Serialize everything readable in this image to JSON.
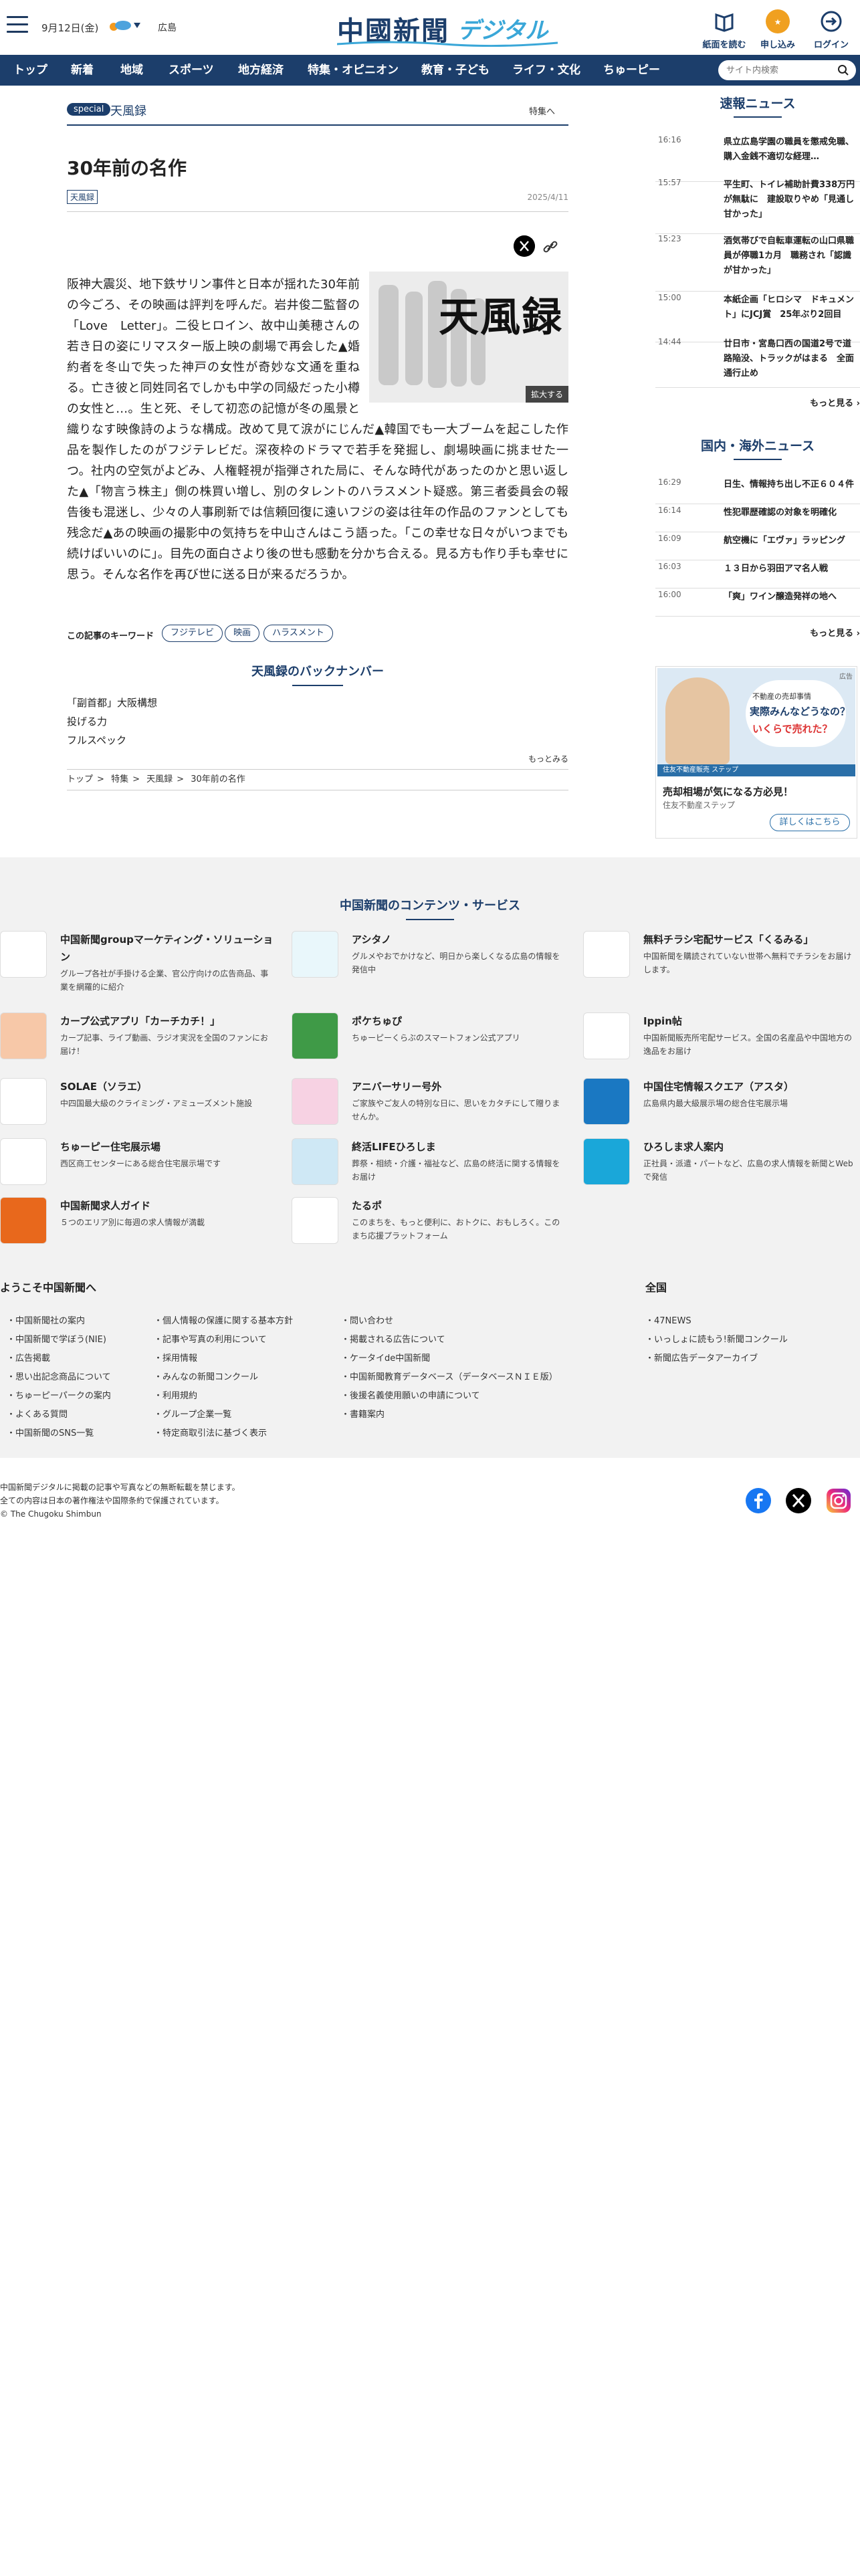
{
  "header": {
    "date": "9月12日(金)",
    "weather_label": "広島",
    "logo_main": "中國新聞",
    "logo_sub": "デジタル",
    "buttons": [
      {
        "label": "紙面を読む",
        "icon": "newspaper-icon"
      },
      {
        "label": "申し込み",
        "icon": "subscribe-icon"
      },
      {
        "label": "ログイン",
        "icon": "login-icon"
      }
    ],
    "colors": {
      "brand": "#1c3e6b",
      "accent": "#3aa7d8",
      "subscribe": "#f0a020"
    }
  },
  "nav": {
    "items": [
      "トップ",
      "新着",
      "地域",
      "スポーツ",
      "地方経済",
      "特集・オピニオン",
      "教育・子ども",
      "ライフ・文化",
      "ちゅーピー"
    ],
    "search_placeholder": "サイト内検索"
  },
  "article": {
    "badge": "special",
    "section": "天風録",
    "special_link": "特集へ",
    "title": "30年前の名作",
    "tag": "天風録",
    "date": "2025/4/11",
    "photo_text": "天風録",
    "enlarge": "拡大する",
    "body": "阪神大震災、地下鉄サリン事件と日本が揺れた30年前の今ごろ、その映画は評判を呼んだ。岩井俊二監督の「Love　Letter」。二役ヒロイン、故中山美穂さんの若き日の姿にリマスター版上映の劇場で再会した▲婚約者を冬山で失った神戸の女性が奇妙な文通を重ねる。亡き彼と同姓同名でしかも中学の同級だった小樽の女性と…。生と死、そして初恋の記憶が冬の風景と織りなす映像詩のような構成。改めて見て涙がにじんだ▲韓国でも一大ブームを起こした作品を製作したのがフジテレビだ。深夜枠のドラマで若手を発掘し、劇場映画に挑ませた一つ。社内の空気がよどみ、人権軽視が指弾された局に、そんな時代があったのかと思い返した▲「物言う株主」側の株買い増し、別のタレントのハラスメント疑惑。第三者委員会の報告後も混迷し、少々の人事刷新では信頼回復に遠いフジの姿は往年の作品のファンとしても残念だ▲あの映画の撮影中の気持ちを中山さんはこう語った。「この幸せな日々がいつまでも続けばいいのに」。目先の面白さより後の世も感動を分かち合える。見る方も作り手も幸せに思う。そんな名作を再び世に送る日が来るだろうか。",
    "keywords_label": "この記事のキーワード",
    "keywords": [
      "フジテレビ",
      "映画",
      "ハラスメント"
    ],
    "backnumber_title": "天風録のバックナンバー",
    "backnumbers": [
      "「副首都」大阪構想",
      "投げる力",
      "フルスペック"
    ],
    "more": "もっとみる",
    "breadcrumb": [
      "トップ",
      "特集",
      "天風録",
      "30年前の名作"
    ]
  },
  "sidebar": {
    "breaking": {
      "title": "速報ニュース",
      "items": [
        {
          "time": "16:16",
          "text": "県立広島学園の職員を懲戒免職、購入金銭不適切な経理…"
        },
        {
          "time": "15:57",
          "text": "平生町、トイレ補助計費338万円が無駄に　建設取りやめ「見通し甘かった」"
        },
        {
          "time": "15:23",
          "text": "酒気帯びで自転車運転の山口県職員が停職1カ月　職務され「認識が甘かった」"
        },
        {
          "time": "15:00",
          "text": "本紙企画「ヒロシマ　ドキュメント」にJCJ賞　25年ぶり2回目"
        },
        {
          "time": "14:44",
          "text": "廿日市・宮島口西の国道2号で道路陥没、トラックがはまる　全面通行止め"
        }
      ],
      "more": "もっと見る"
    },
    "world": {
      "title": "国内・海外ニュース",
      "items": [
        {
          "time": "16:29",
          "text": "日生、情報持ち出し不正６０４件"
        },
        {
          "time": "16:14",
          "text": "性犯罪歴確認の対象を明確化"
        },
        {
          "time": "16:09",
          "text": "航空機に「エヴァ」ラッピング"
        },
        {
          "time": "16:03",
          "text": "１３日から羽田アマ名人戦"
        },
        {
          "time": "16:00",
          "text": "「爽」ワイン醸造発祥の地へ"
        }
      ],
      "more": "もっと見る"
    },
    "ad": {
      "flag": "広告",
      "bubble_1": "不動産の売却事情",
      "bubble_2": "実際みんなどうなの？",
      "bubble_3": "いくらで売れた？",
      "strip": "住友不動産販売 ステップ",
      "title": "売却相場が気になる方必見！",
      "sub": "住友不動産ステップ",
      "button": "詳しくはこちら"
    }
  },
  "services": {
    "title": "中国新聞のコンテンツ・サービス",
    "items": [
      {
        "title": "中国新聞groupマーケティング・ソリューション",
        "desc": "グループ各社が手掛ける企業、官公庁向けの広告商品、事業を網羅的に紹介",
        "icon": "marketing-icon",
        "color": "#ffffff"
      },
      {
        "title": "アシタノ",
        "desc": "グルメやおでかけなど、明日から楽しくなる広島の情報を発信中",
        "icon": "ashitano-icon",
        "color": "#e9f7fb"
      },
      {
        "title": "無料チラシ宅配サービス「くるみる」",
        "desc": "中国新聞を購読されていない世帯へ無料でチラシをお届けします。",
        "icon": "kurumiru-icon",
        "color": "#ffffff"
      },
      {
        "title": "カープ公式アプリ「カーチカチ！」",
        "desc": "カープ記事、ライブ動画、ラジオ実況を全国のファンにお届け！",
        "icon": "carp-app-icon",
        "color": "#f7c8a8"
      },
      {
        "title": "ポケちゅぴ",
        "desc": "ちゅーピーくらぶのスマートフォン公式アプリ",
        "icon": "pokechupi-icon",
        "color": "#3f9a47"
      },
      {
        "title": "Ippin帖",
        "desc": "中国新聞販売所宅配サービス。全国の名産品や中国地方の逸品をお届け",
        "icon": "ippin-icon",
        "color": "#ffffff"
      },
      {
        "title": "SOLAE（ソラエ）",
        "desc": "中四国最大級のクライミング・アミューズメント施設",
        "icon": "solae-icon",
        "color": "#ffffff"
      },
      {
        "title": "アニバーサリー号外",
        "desc": "ご家族やご友人の特別な日に、思いをカタチにして贈りませんか。",
        "icon": "anniversary-icon",
        "color": "#f7d2e3"
      },
      {
        "title": "中国住宅情報スクエア（アスタ）",
        "desc": "広島県内最大級展示場の総合住宅展示場",
        "icon": "asta-icon",
        "color": "#1a78c2"
      },
      {
        "title": "ちゅーピー住宅展示場",
        "desc": "西区商工センターにある総合住宅展示場です",
        "icon": "chupy-house-icon",
        "color": "#ffffff"
      },
      {
        "title": "終活LIFEひろしま",
        "desc": "葬祭・相続・介護・福祉など、広島の終活に関する情報をお届け",
        "icon": "shukatsu-icon",
        "color": "#cfe8f5"
      },
      {
        "title": "ひろしま求人案内",
        "desc": "正社員・派遣・パートなど、広島の求人情報を新聞とWebで発信",
        "icon": "kyujin-hiroshima-icon",
        "color": "#1aa7d9"
      },
      {
        "title": "中国新聞求人ガイド",
        "desc": "５つのエリア別に毎週の求人情報が満載",
        "icon": "kyujin-guide-icon",
        "color": "#e8681c"
      },
      {
        "title": "たるポ",
        "desc": "このまちを、もっと便利に、おトクに、おもしろく。このまち応援プラットフォーム",
        "icon": "tarupo-icon",
        "color": "#ffffff"
      }
    ]
  },
  "links": {
    "welcome_title": "ようこそ中国新聞へ",
    "zenkoku_title": "全国",
    "col1": [
      "中国新聞社の案内",
      "中国新聞で学ぼう(NIE)",
      "広告掲載",
      "思い出記念商品について",
      "ちゅーピーパークの案内",
      "よくある質問",
      "中国新聞のSNS一覧"
    ],
    "col2": [
      "個人情報の保護に関する基本方針",
      "記事や写真の利用について",
      "採用情報",
      "みんなの新聞コンクール",
      "利用規約",
      "グループ企業一覧",
      "特定商取引法に基づく表示"
    ],
    "col3": [
      "問い合わせ",
      "掲載される広告について",
      "ケータイde中国新聞",
      "中国新聞教育データベース（データベースＮＩＥ版）",
      "後援名義使用願いの申請について",
      "書籍案内"
    ],
    "col4": [
      "47NEWS",
      "いっしょに読もう!新聞コンクール",
      "新聞広告データアーカイブ"
    ]
  },
  "footer": {
    "line1": "中国新聞デジタルに掲載の記事や写真などの無断転載を禁じます。",
    "line2": "全ての内容は日本の著作権法や国際条約で保護されています。",
    "line3": "© The Chugoku Shimbun",
    "social": [
      "facebook-icon",
      "x-icon",
      "instagram-icon"
    ]
  }
}
